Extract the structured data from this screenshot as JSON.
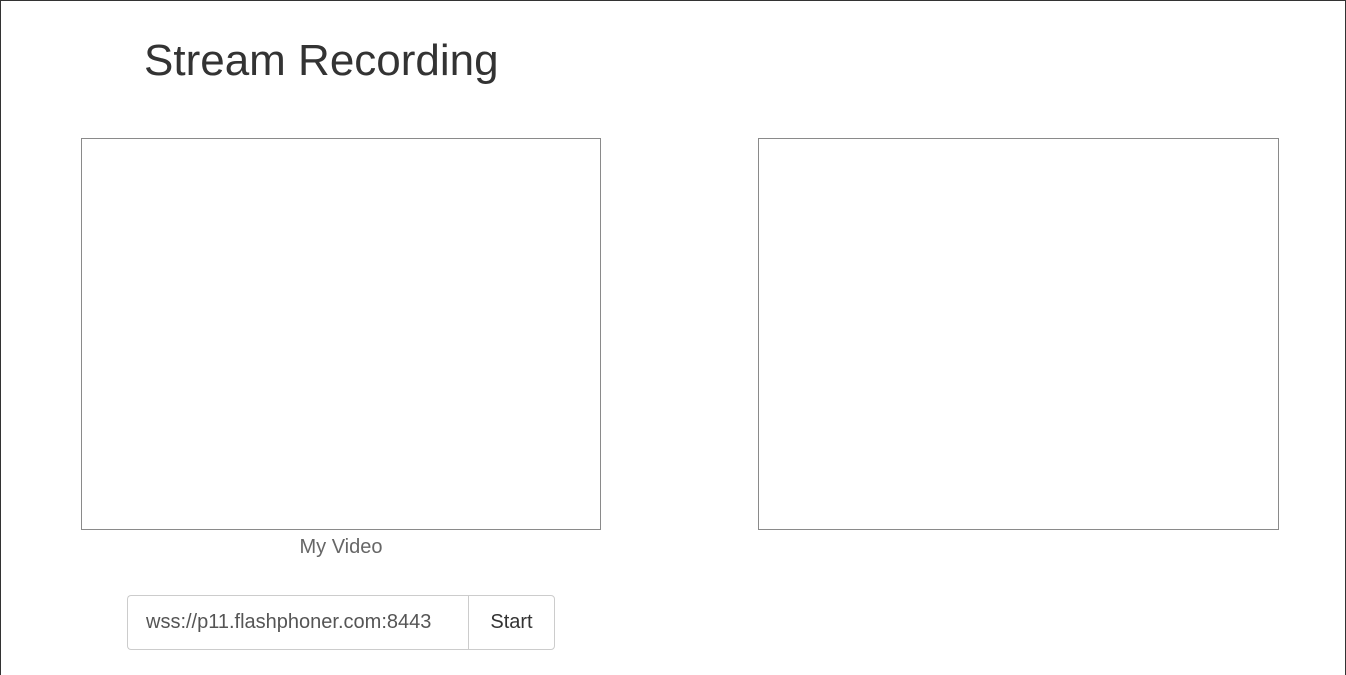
{
  "page": {
    "title": "Stream Recording"
  },
  "local_video": {
    "caption": "My Video"
  },
  "connection": {
    "url_value": "wss://p11.flashphoner.com:8443",
    "start_label": "Start"
  },
  "colors": {
    "text": "#333333",
    "caption": "#666666",
    "video_border": "#8a8a8a",
    "control_border": "#cccccc"
  }
}
